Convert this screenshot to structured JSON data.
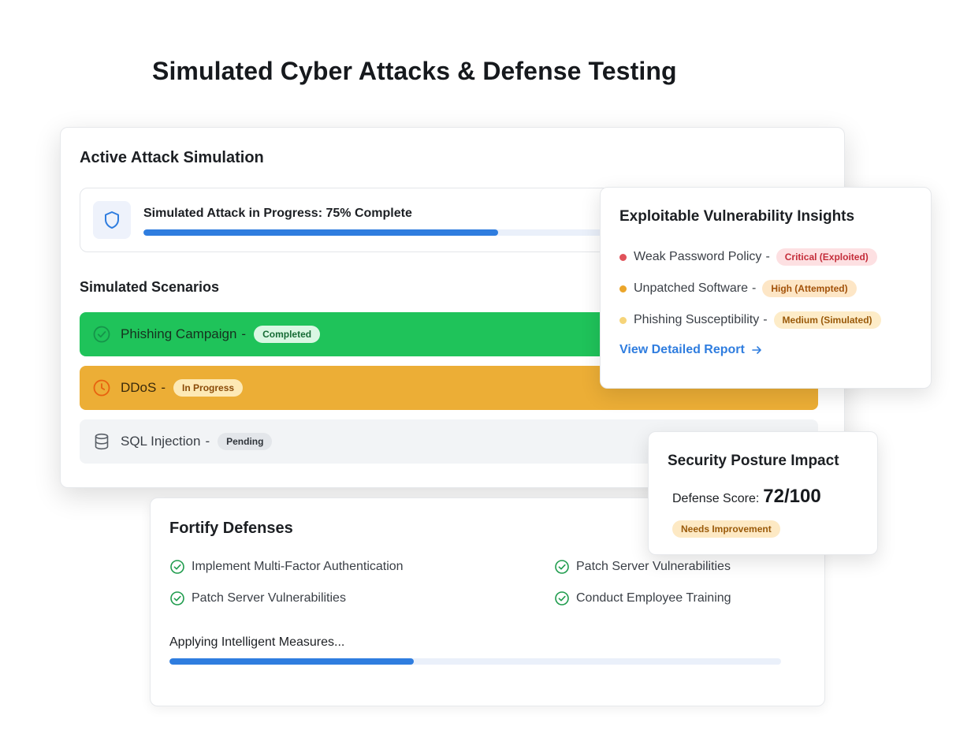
{
  "page": {
    "title": "Simulated Cyber Attacks & Defense Testing"
  },
  "simulation": {
    "title": "Active Attack Simulation",
    "progress_text": "Simulated Attack in Progress: 75% Complete",
    "progress_percent": 75,
    "scenarios_title": "Simulated Scenarios",
    "scenarios": [
      {
        "label": "Phishing Campaign",
        "separator": "-",
        "status": "Completed",
        "icon": "check-circle-icon"
      },
      {
        "label": "DDoS",
        "separator": "-",
        "status": "In Progress",
        "icon": "clock-icon"
      },
      {
        "label": "SQL Injection",
        "separator": "-",
        "status": "Pending",
        "icon": "database-icon"
      }
    ]
  },
  "vulnerabilities": {
    "title": "Exploitable Vulnerability Insights",
    "items": [
      {
        "label": "Weak Password Policy",
        "separator": "-",
        "severity": "Critical (Exploited)",
        "color": "#e0525a"
      },
      {
        "label": "Unpatched Software",
        "separator": "-",
        "severity": "High (Attempted)",
        "color": "#eba52a"
      },
      {
        "label": "Phishing Susceptibility",
        "separator": "-",
        "severity": "Medium (Simulated)",
        "color": "#f6d479"
      }
    ],
    "link_label": "View Detailed Report"
  },
  "posture": {
    "title": "Security Posture Impact",
    "score_label": "Defense Score:",
    "score_value": "72/100",
    "badge": "Needs Improvement"
  },
  "fortify": {
    "title": "Fortify Defenses",
    "measures": [
      "Implement Multi-Factor Authentication",
      "Patch Server Vulnerabilities",
      "Patch Server Vulnerabilities",
      "Conduct Employee Training"
    ],
    "applying_text": "Applying Intelligent Measures...",
    "applying_progress_percent": 40
  },
  "colors": {
    "accent": "#2f7ddf",
    "success": "#1fc35a",
    "warning": "#ecae36",
    "check": "#1f9c4d"
  }
}
